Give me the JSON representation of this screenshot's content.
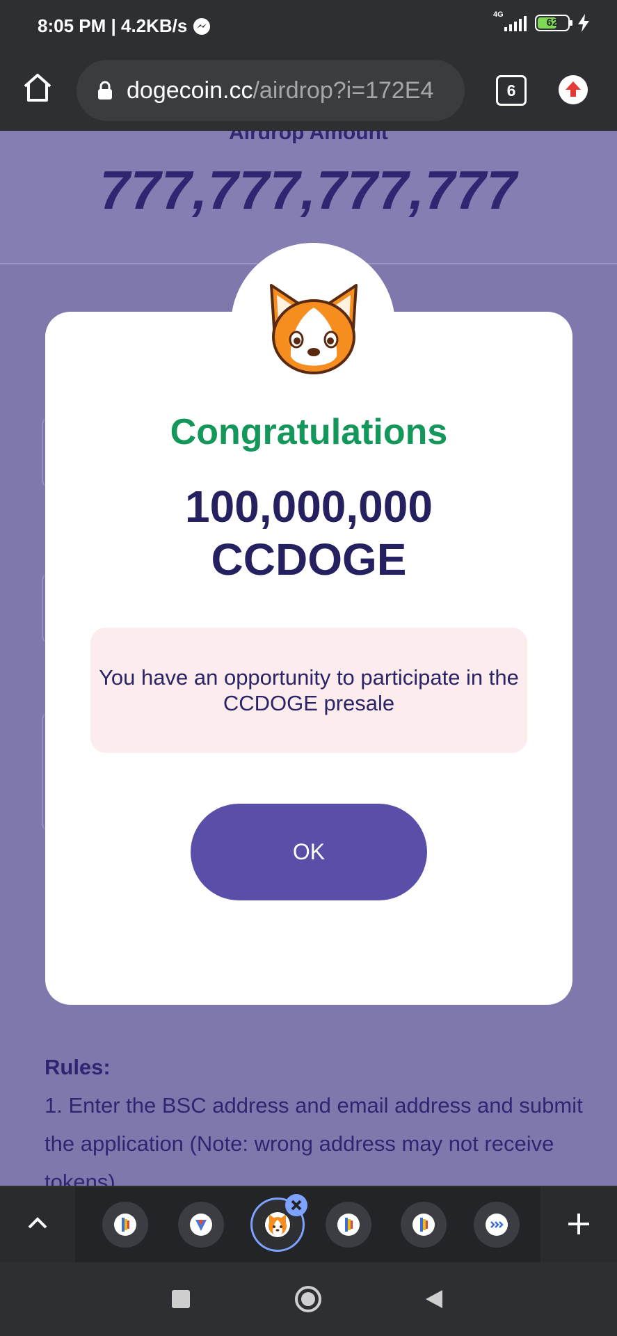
{
  "status_bar": {
    "time_speed": "8:05 PM | 4.2KB/s",
    "network": "4G",
    "battery": "62"
  },
  "browser": {
    "url_domain": "dogecoin.cc",
    "url_path": "/airdrop?i=172E4",
    "tab_count": "6"
  },
  "page": {
    "airdrop_label": "Airdrop Amount",
    "airdrop_amount": "777,777,777,777",
    "rules_title": "Rules:",
    "rules_text": "1. Enter the BSC address and email address and submit the application (Note: wrong address may not receive tokens)."
  },
  "modal": {
    "title": "Congratulations",
    "amount_line1": "100,000,000",
    "amount_line2": "CCDOGE",
    "notice": "You have an opportunity to participate in the CCDOGE presale",
    "ok_label": "OK"
  },
  "tabs": {
    "items": [
      "app-tab",
      "app-tab",
      "doge-tab-active",
      "app-tab",
      "app-tab",
      "overflow-tab"
    ]
  },
  "colors": {
    "title_green": "#14975a",
    "amount_navy": "#252160",
    "button_purple": "#5a4fa8",
    "page_bg": "#7f78ad"
  }
}
